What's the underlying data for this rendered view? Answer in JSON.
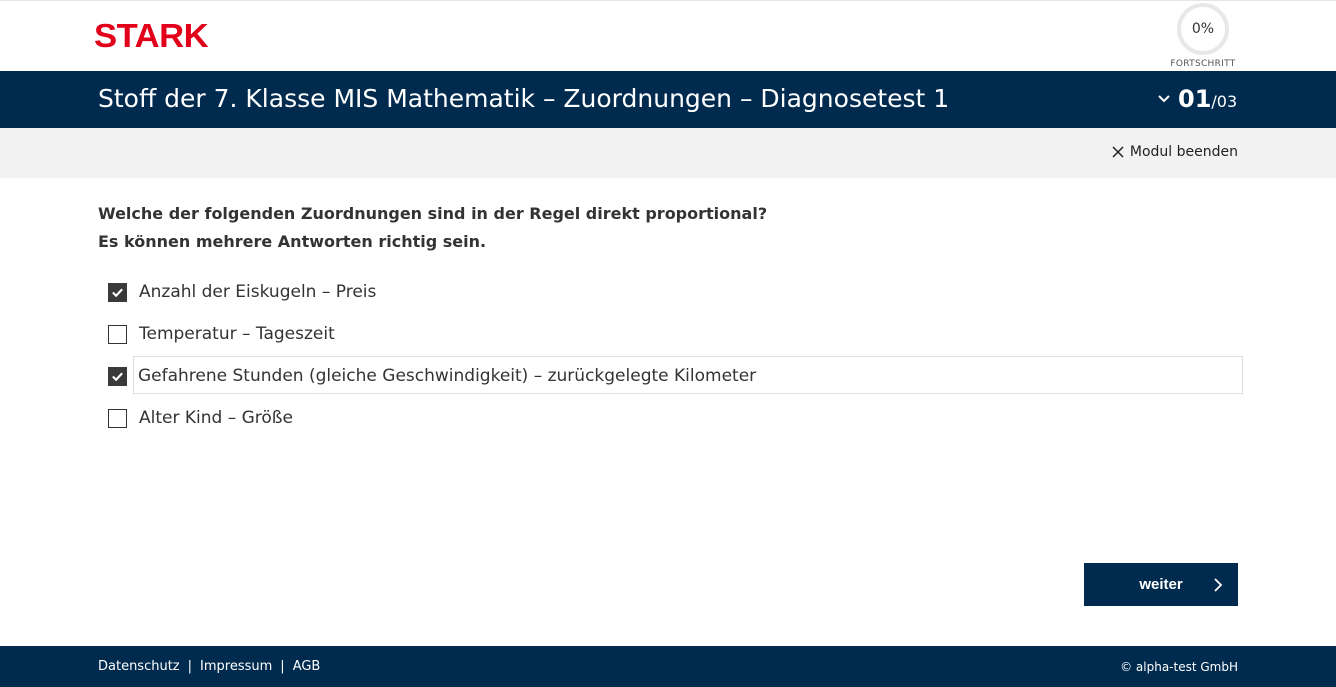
{
  "header": {
    "logo_text": "STARK",
    "progress_value": "0%",
    "progress_label": "FORTSCHRITT"
  },
  "titlebar": {
    "title": "Stoff der 7. Klasse MIS Mathematik – Zuordnungen – Diagnosetest 1",
    "page_current": "01",
    "page_total": "/03"
  },
  "subbar": {
    "end_module_label": "Modul beenden"
  },
  "question": {
    "line1": "Welche der folgenden Zuordnungen sind in der Regel direkt proportional?",
    "line2": "Es können mehrere Antworten richtig sein."
  },
  "answers": [
    {
      "label": "Anzahl der Eiskugeln – Preis",
      "checked": true
    },
    {
      "label": "Temperatur – Tageszeit",
      "checked": false
    },
    {
      "label": "Gefahrene Stunden (gleiche Geschwindigkeit) – zurückgelegte Kilometer",
      "checked": true
    },
    {
      "label": "Alter Kind – Größe",
      "checked": false
    }
  ],
  "next_button": {
    "label": "weiter"
  },
  "footer": {
    "links": [
      "Datenschutz",
      "Impressum",
      "AGB"
    ],
    "copyright": "© alpha-test GmbH"
  },
  "colors": {
    "brand_red": "#e2001a",
    "navy": "#002b4f",
    "grey_bar": "#f2f2f2"
  }
}
